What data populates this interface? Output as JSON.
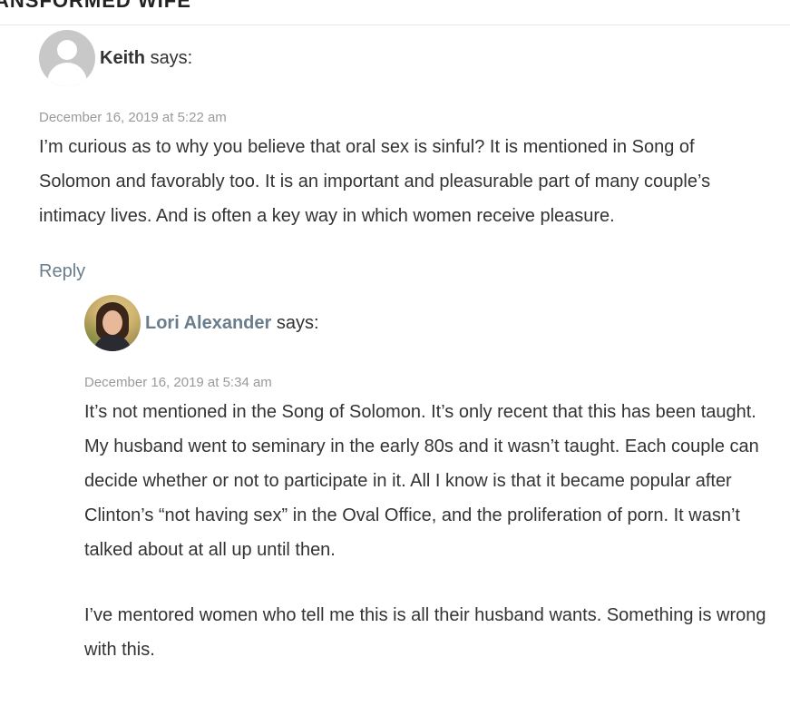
{
  "header": {
    "site_title": "ANSFORMED WIFE"
  },
  "comments": [
    {
      "author": "Keith",
      "says": "says:",
      "date": "December 16, 2019 at 5:22 am",
      "text": [
        "I’m curious as to why you believe that oral sex is sinful? It is mentioned in Song of Solomon and favorably too. It is an important and pleasurable part of many couple’s intimacy lives. And is often a key way in which women receive pleasure."
      ],
      "reply_label": "Reply",
      "avatar_icon": "default-user-avatar-icon"
    },
    {
      "author": "Lori Alexander",
      "says": "says:",
      "date": "December 16, 2019 at 5:34 am",
      "text": [
        "It’s not mentioned in the Song of Solomon. It’s only recent that this has been taught. My husband went to seminary in the early 80s and it wasn’t taught. Each couple can decide whether or not to participate in it. All I know is that it became popular after Clinton’s “not having sex” in the Oval Office, and the proliferation of porn. It wasn’t talked about at all up until then.",
        "I’ve mentored women who tell me this is all their husband wants. Something is wrong with this."
      ],
      "avatar_icon": "user-photo-avatar"
    }
  ],
  "colors": {
    "text": "#333333",
    "meta": "#9a9a9a",
    "link": "#6a7d8c",
    "divider": "#e6e6e6"
  }
}
